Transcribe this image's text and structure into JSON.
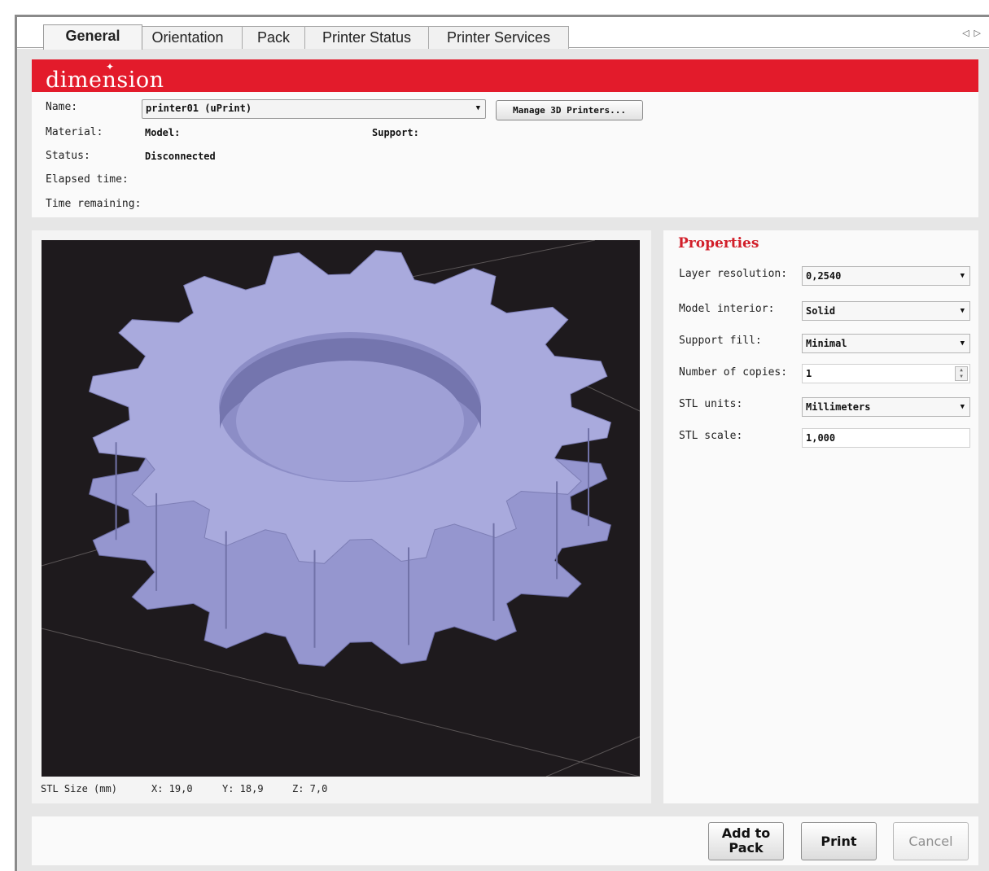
{
  "tabs": [
    {
      "label": "General",
      "active": true
    },
    {
      "label": "Orientation",
      "active": false
    },
    {
      "label": "Pack",
      "active": false
    },
    {
      "label": "Printer Status",
      "active": false
    },
    {
      "label": "Printer Services",
      "active": false
    }
  ],
  "brand": {
    "logo_text": "dimension",
    "color": "#e31b2b"
  },
  "info": {
    "name_label": "Name:",
    "printer_value": "printer01  (uPrint)",
    "manage_button": "Manage 3D Printers...",
    "material_label": "Material:",
    "model_label": "Model:",
    "support_label": "Support:",
    "status_label": "Status:",
    "status_value": "Disconnected",
    "elapsed_label": "Elapsed time:",
    "remaining_label": "Time remaining:"
  },
  "viewer": {
    "stl_size_label": "STL Size (mm)",
    "x": "X: 19,0",
    "y": "Y: 18,9",
    "z": "Z: 7,0",
    "model_color": "#a3a4d6"
  },
  "properties": {
    "title": "Properties",
    "title_color": "#d21f2a",
    "layer_resolution_label": "Layer resolution:",
    "layer_resolution_value": "0,2540",
    "model_interior_label": "Model interior:",
    "model_interior_value": "Solid",
    "support_fill_label": "Support fill:",
    "support_fill_value": "Minimal",
    "copies_label": "Number of copies:",
    "copies_value": "1",
    "stl_units_label": "STL units:",
    "stl_units_value": "Millimeters",
    "stl_scale_label": "STL scale:",
    "stl_scale_value": "1,000"
  },
  "actions": {
    "add_to_pack_line1": "Add to",
    "add_to_pack_line2": "Pack",
    "print": "Print",
    "cancel": "Cancel"
  }
}
